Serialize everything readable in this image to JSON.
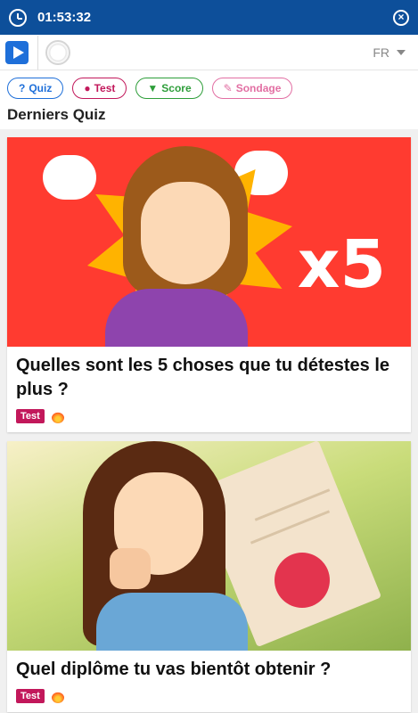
{
  "status": {
    "time": "01:53:32"
  },
  "header": {
    "language": "FR"
  },
  "tabs": [
    {
      "label": "Quiz",
      "icon": "question-icon"
    },
    {
      "label": "Test",
      "icon": "head-icon"
    },
    {
      "label": "Score",
      "icon": "trophy-icon"
    },
    {
      "label": "Sondage",
      "icon": "edit-icon"
    }
  ],
  "section_title": "Derniers Quiz",
  "cards": [
    {
      "title": "Quelles sont les 5 choses que tu détestes le plus ?",
      "badge": "Test",
      "image_text": "x5",
      "icon": "flame-icon"
    },
    {
      "title": "Quel diplôme tu vas bientôt obtenir ?",
      "badge": "Test",
      "icon": "flame-icon"
    }
  ],
  "colors": {
    "status_bar": "#0d4f9a",
    "quiz": "#1e6fd9",
    "test": "#c2185b",
    "score": "#2e9e3a",
    "sondage": "#e26fa3"
  }
}
